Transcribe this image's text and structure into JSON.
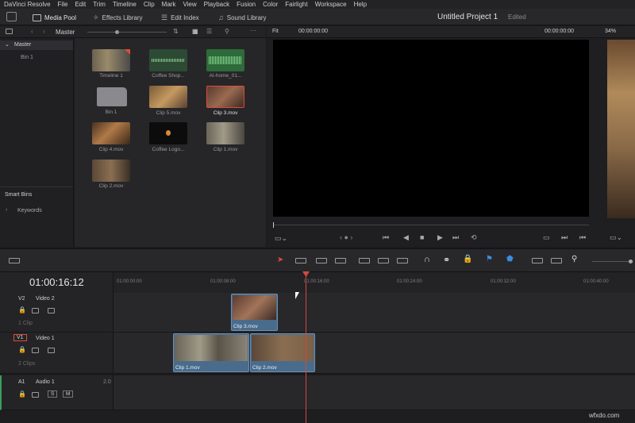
{
  "menu": [
    "DaVinci Resolve",
    "File",
    "Edit",
    "Trim",
    "Timeline",
    "Clip",
    "Mark",
    "View",
    "Playback",
    "Fusion",
    "Color",
    "Fairlight",
    "Workspace",
    "Help"
  ],
  "toolbar": {
    "media_pool": "Media Pool",
    "effects_library": "Effects Library",
    "edit_index": "Edit Index",
    "sound_library": "Sound Library"
  },
  "project": {
    "title": "Untitled Project 1",
    "status": "Edited"
  },
  "media_pool": {
    "folder": "Master",
    "bins": [
      "Master",
      "Bin 1"
    ],
    "smart_bins_title": "Smart Bins",
    "smart_bins": [
      "Keywords"
    ],
    "items": [
      {
        "label": "Timeline 1"
      },
      {
        "label": "Coffee Shop..."
      },
      {
        "label": "AI-home_01..."
      },
      {
        "label": "Bin 1"
      },
      {
        "label": "Clip 5.mov"
      },
      {
        "label": "Clip 3.mov"
      },
      {
        "label": "Clip 4.mov"
      },
      {
        "label": "Coffee Logo..."
      },
      {
        "label": "Clip 1.mov"
      },
      {
        "label": "Clip 2.mov"
      }
    ]
  },
  "viewer": {
    "fit": "Fit",
    "source_tc": "00:00:00:00",
    "program_tc": "00:00:00:00",
    "zoom": "34%"
  },
  "timeline": {
    "timecode": "01:00:16:12",
    "ruler": [
      "01:00:00:00",
      "01:00:08:00",
      "01:00:16:00",
      "01:00:24:00",
      "01:00:32:00",
      "01:00:40:00"
    ],
    "tracks": [
      {
        "id": "V2",
        "name": "Video 2",
        "count": "1 Clip"
      },
      {
        "id": "V1",
        "name": "Video 1",
        "count": "2 Clips"
      },
      {
        "id": "A1",
        "name": "Audio 1",
        "level": "2.0",
        "solo": "S",
        "mute": "M"
      }
    ],
    "clips": {
      "v2": [
        {
          "label": "Clip 3.mov"
        }
      ],
      "v1": [
        {
          "label": "Clip 1.mov"
        },
        {
          "label": "Clip 2.mov"
        }
      ]
    }
  },
  "watermark": "wfxdo.com",
  "colors": {
    "accent": "#e04a3a",
    "clip": "#4a6c8c",
    "playhead": "#d24a3c"
  }
}
